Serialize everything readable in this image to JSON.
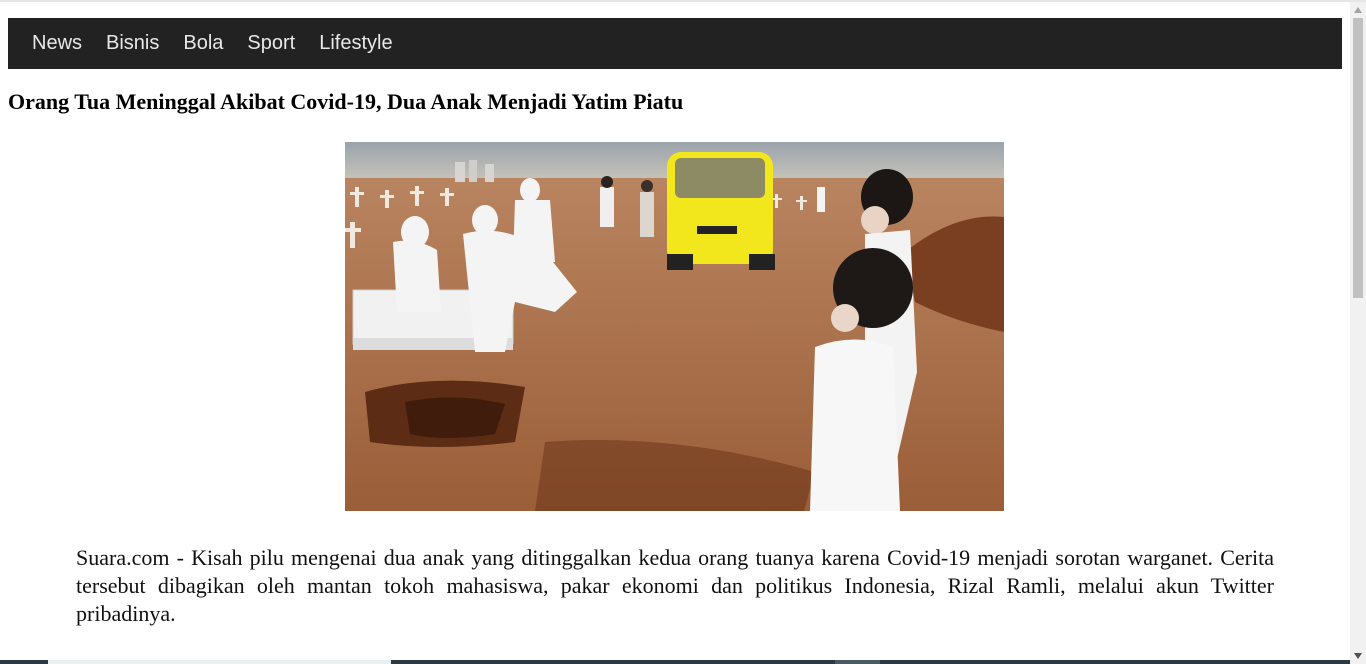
{
  "nav": {
    "items": [
      {
        "label": "News"
      },
      {
        "label": "Bisnis"
      },
      {
        "label": "Bola"
      },
      {
        "label": "Sport"
      },
      {
        "label": "Lifestyle"
      }
    ]
  },
  "article": {
    "headline": "Orang Tua Meninggal Akibat Covid-19, Dua Anak Menjadi Yatim Piatu",
    "body": "Suara.com - Kisah pilu mengenai dua anak yang ditinggalkan kedua orang tuanya karena Covid-19 menjadi sorotan warganet. Cerita tersebut dibagikan oleh mantan tokoh mahasiswa, pakar ekonomi dan politikus Indonesia, Rizal Ramli, melalui akun Twitter pribadinya."
  },
  "colors": {
    "navbar_bg": "#222222",
    "nav_text": "#e8e8e8",
    "page_bg": "#ffffff"
  },
  "icons": {
    "scroll_up": "scroll-up-arrow-icon",
    "scroll_down": "scroll-down-arrow-icon"
  }
}
